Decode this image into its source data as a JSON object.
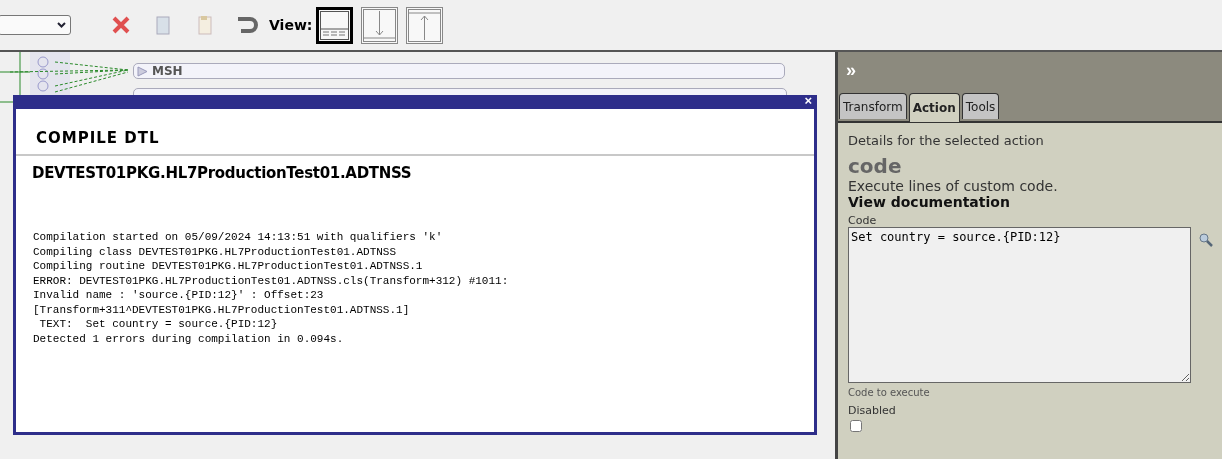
{
  "toolbar": {
    "view": {
      "label": "View:",
      "options": [
        {
          "kind": "split",
          "selected": true
        },
        {
          "kind": "down",
          "selected": false
        },
        {
          "kind": "up",
          "selected": false
        }
      ]
    }
  },
  "canvas": {
    "segment": "MSH"
  },
  "dialog": {
    "close": "×",
    "title": "COMPILE DTL",
    "heading": "DEVTEST01PKG.HL7ProductionTest01.ADTNSS",
    "log": [
      "Compilation started on 05/09/2024 14:13:51 with qualifiers 'k'",
      "Compiling class DEVTEST01PKG.HL7ProductionTest01.ADTNSS",
      "Compiling routine DEVTEST01PKG.HL7ProductionTest01.ADTNSS.1",
      "ERROR: DEVTEST01PKG.HL7ProductionTest01.ADTNSS.cls(Transform+312) #1011:",
      "Invalid name : 'source.{PID:12}' : Offset:23",
      "[Transform+311^DEVTEST01PKG.HL7ProductionTest01.ADTNSS.1]",
      " TEXT:  Set country = source.{PID:12}",
      "Detected 1 errors during compilation in 0.094s."
    ]
  },
  "panel": {
    "collapse": "»",
    "tabs": [
      {
        "label": "Transform",
        "selected": false
      },
      {
        "label": "Action",
        "selected": true
      },
      {
        "label": "Tools",
        "selected": false
      }
    ],
    "intro": "Details for the selected action",
    "action_name": "code",
    "description": "Execute lines of custom code.",
    "doc_link": "View documentation",
    "field_label": "Code",
    "code": "Set country = source.{PID:12}",
    "hint": "Code to execute",
    "disabled": {
      "label": "Disabled",
      "checked": false
    }
  }
}
